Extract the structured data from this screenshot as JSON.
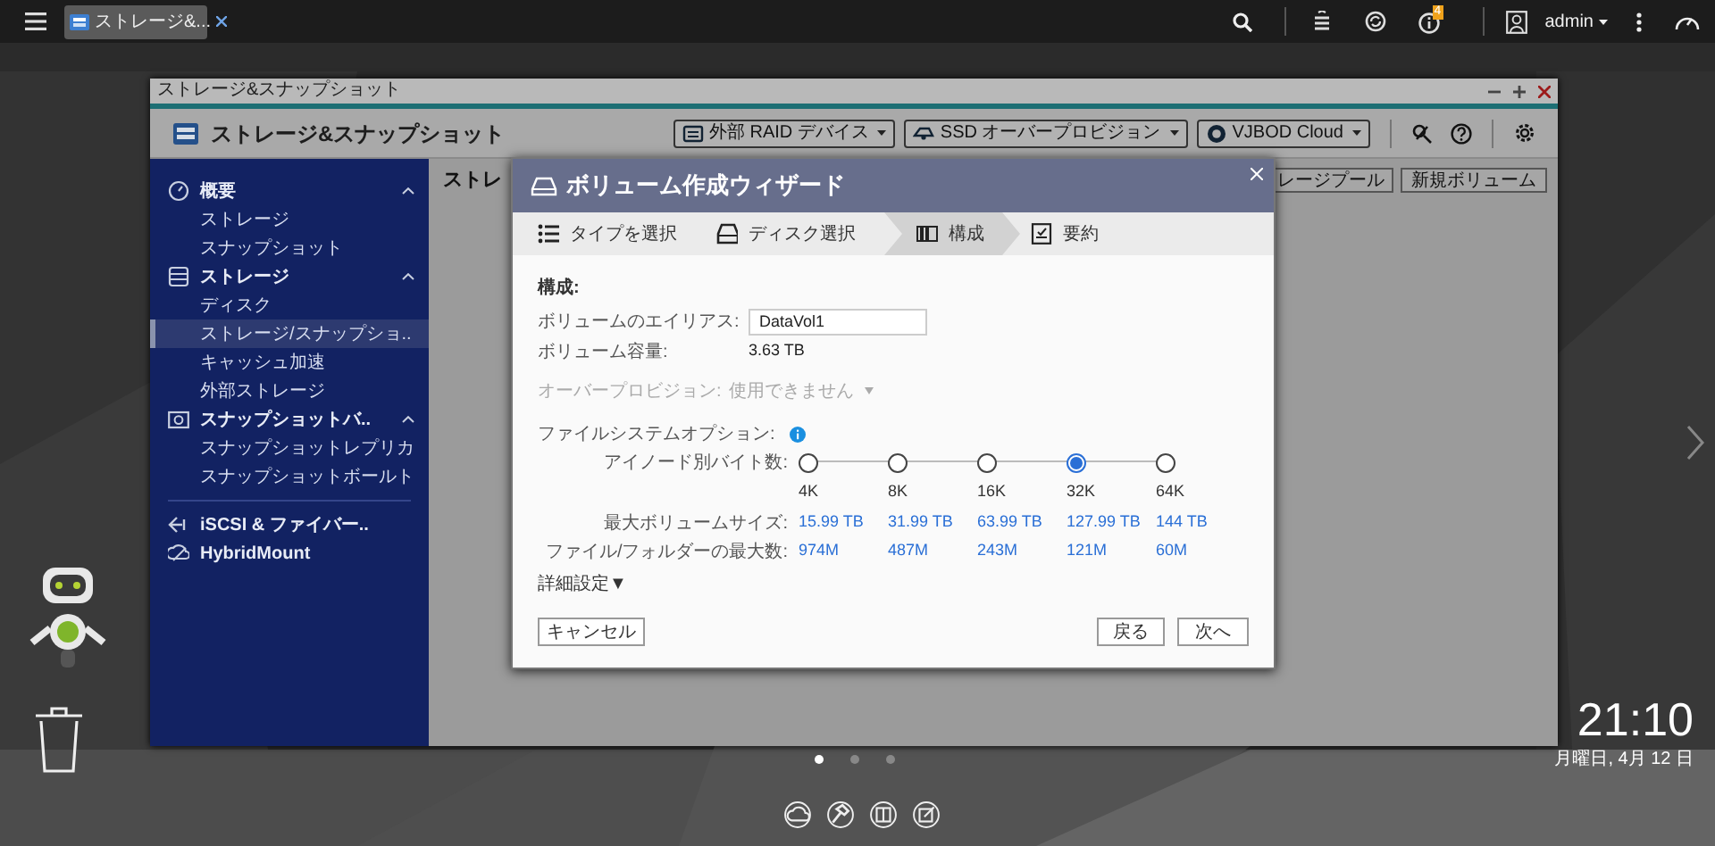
{
  "taskbar": {
    "tabs": [
      {
        "label": "ストレージ&...",
        "selected": true
      }
    ],
    "notification_count": "4",
    "user": "admin"
  },
  "window": {
    "title": "ストレージ&スナップショット",
    "app_title": "ストレージ&スナップショット",
    "toolbar": [
      "外部 RAID デバイス",
      "SSD オーバープロビジョン",
      "VJBOD Cloud"
    ],
    "sidebar": [
      {
        "label": "概要",
        "expanded": true,
        "children": [
          {
            "label": "ストレージ",
            "selected": false
          },
          {
            "label": "スナップショット",
            "selected": false
          }
        ]
      },
      {
        "label": "ストレージ",
        "expanded": true,
        "children": [
          {
            "label": "ディスク",
            "selected": false
          },
          {
            "label": "ストレージ/スナップショ..",
            "selected": true
          },
          {
            "label": "キャッシュ加速",
            "selected": false
          },
          {
            "label": "外部ストレージ",
            "selected": false
          }
        ]
      },
      {
        "label": "スナップショットバ..",
        "expanded": true,
        "children": [
          {
            "label": "スナップショットレプリカ",
            "selected": false
          },
          {
            "label": "スナップショットボールト",
            "selected": false
          }
        ]
      },
      {
        "label": "iSCSI & ファイバー.."
      },
      {
        "label": "HybridMount"
      }
    ],
    "content": {
      "heading": "ストレ",
      "buttons": [
        "レージプール",
        "新規ボリューム"
      ]
    }
  },
  "wizard": {
    "title": "ボリューム作成ウィザード",
    "steps": [
      {
        "label": "タイプを選択",
        "selected": false
      },
      {
        "label": "ディスク選択",
        "selected": false
      },
      {
        "label": "構成",
        "selected": true
      },
      {
        "label": "要約",
        "selected": false
      }
    ],
    "section": "構成:",
    "alias": {
      "label": "ボリュームのエイリアス:",
      "value": "DataVol1"
    },
    "capacity": {
      "label": "ボリューム容量:",
      "value": "3.63 TB"
    },
    "over_provisioning": {
      "label": "オーバープロビジョン:",
      "value": "使用できません",
      "disabled": true
    },
    "fs_options": {
      "label": "ファイルシステムオプション:",
      "inode_label": "アイノード別バイト数:",
      "max_volume_label": "最大ボリュームサイズ:",
      "max_files_label": "ファイル/フォルダーの最大数:",
      "options": [
        {
          "label": "4K",
          "max_volume": "15.99 TB",
          "max_files": "974M",
          "selected": false
        },
        {
          "label": "8K",
          "max_volume": "31.99 TB",
          "max_files": "487M",
          "selected": false
        },
        {
          "label": "16K",
          "max_volume": "63.99 TB",
          "max_files": "243M",
          "selected": false
        },
        {
          "label": "32K",
          "max_volume": "127.99 TB",
          "max_files": "121M",
          "selected": true
        },
        {
          "label": "64K",
          "max_volume": "144 TB",
          "max_files": "60M",
          "selected": false
        }
      ]
    },
    "advanced": "詳細設定▼",
    "buttons": {
      "cancel": "キャンセル",
      "back": "戻る",
      "next": "次へ"
    }
  },
  "desktop": {
    "time": "21:10",
    "date": "月曜日, 4月 12 日",
    "pages": [
      {
        "selected": true
      },
      {
        "selected": false
      },
      {
        "selected": false
      }
    ]
  }
}
